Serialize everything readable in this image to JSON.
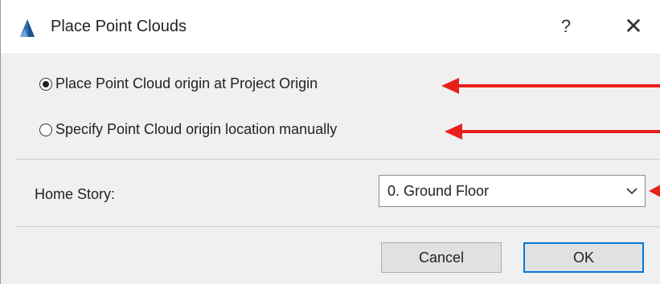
{
  "dialog": {
    "title": "Place Point Clouds",
    "help_label": "?",
    "close_label": "✕"
  },
  "options": [
    {
      "label": "Place Point Cloud origin at Project Origin",
      "selected": true
    },
    {
      "label": "Specify Point Cloud origin location manually",
      "selected": false
    }
  ],
  "home_story": {
    "label": "Home Story:",
    "value": "0. Ground Floor"
  },
  "buttons": {
    "cancel": "Cancel",
    "ok": "OK"
  },
  "colors": {
    "annotation_arrow": "#e8201c",
    "default_button_border": "#0078d7"
  },
  "icons": {
    "app": "archicad-app-icon",
    "chevron": "chevron-down-icon",
    "arrow": "red-arrow-icon"
  }
}
